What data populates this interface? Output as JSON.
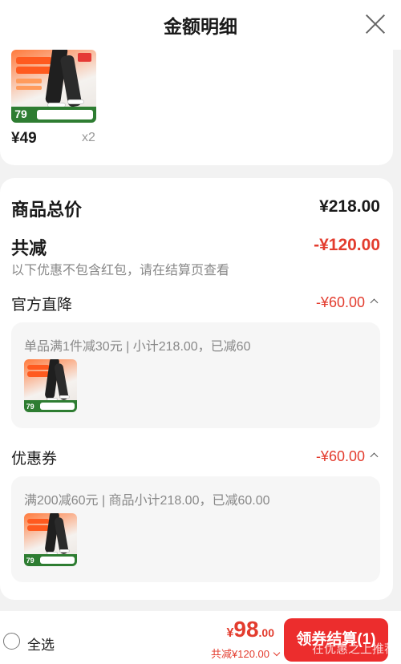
{
  "header": {
    "title": "金额明细",
    "close_icon": "close-icon"
  },
  "top_item": {
    "price": "¥49",
    "qty": "x2",
    "image_price": "79",
    "image_badge_1": "加绒加厚",
    "image_badge_2": "保暖锁温"
  },
  "summary": {
    "total_label": "商品总价",
    "total_value": "¥218.00",
    "discount_label": "共减",
    "discount_value": "-¥120.00",
    "discount_note": "以下优惠不包含红包，请在结算页查看"
  },
  "sections": [
    {
      "label": "官方直降",
      "amount": "-¥60.00",
      "desc": "单品满1件减30元 | 小计218.00，已减60",
      "image_price": "79"
    },
    {
      "label": "优惠券",
      "amount": "-¥60.00",
      "desc": "满200减60元 | 商品小计218.00，已减60.00",
      "image_price": "79"
    }
  ],
  "bottom": {
    "select_all": "全选",
    "currency": "¥",
    "total_int": "98",
    "total_dec": ".00",
    "saved": "共减¥120.00",
    "cta": "领券结算(1)",
    "watermark": "在优惠之上推荐"
  },
  "colors": {
    "accent_red": "#e33c2e",
    "cta_red": "#ec2d2d"
  }
}
